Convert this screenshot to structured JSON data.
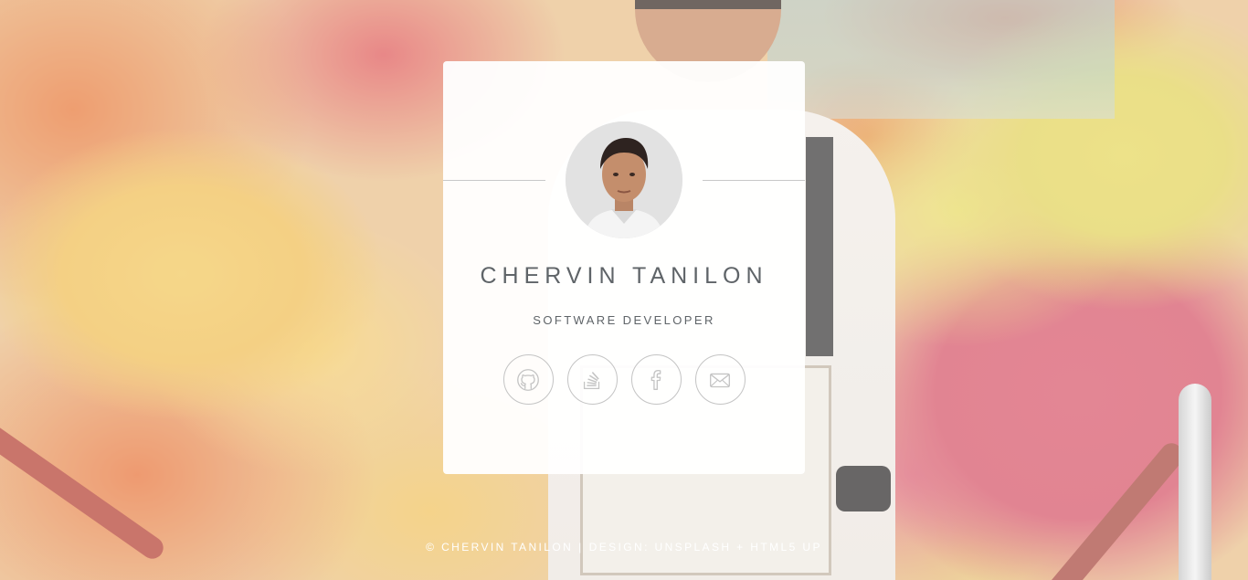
{
  "profile": {
    "name": "CHERVIN TANILON",
    "title": "SOFTWARE DEVELOPER"
  },
  "social_links": [
    {
      "label": "GitHub",
      "icon": "github-icon"
    },
    {
      "label": "Stack Overflow",
      "icon": "stackoverflow-icon"
    },
    {
      "label": "Facebook",
      "icon": "facebook-icon"
    },
    {
      "label": "Email",
      "icon": "mail-icon"
    }
  ],
  "footer": {
    "copyright": "© CHERVIN TANILON",
    "separator": "|",
    "credit": "DESIGN: UNSPLASH + HTML5 UP"
  },
  "colors": {
    "text": "#5f6468",
    "icon_stroke": "#c4c4c4",
    "card_background": "#ffffff"
  }
}
